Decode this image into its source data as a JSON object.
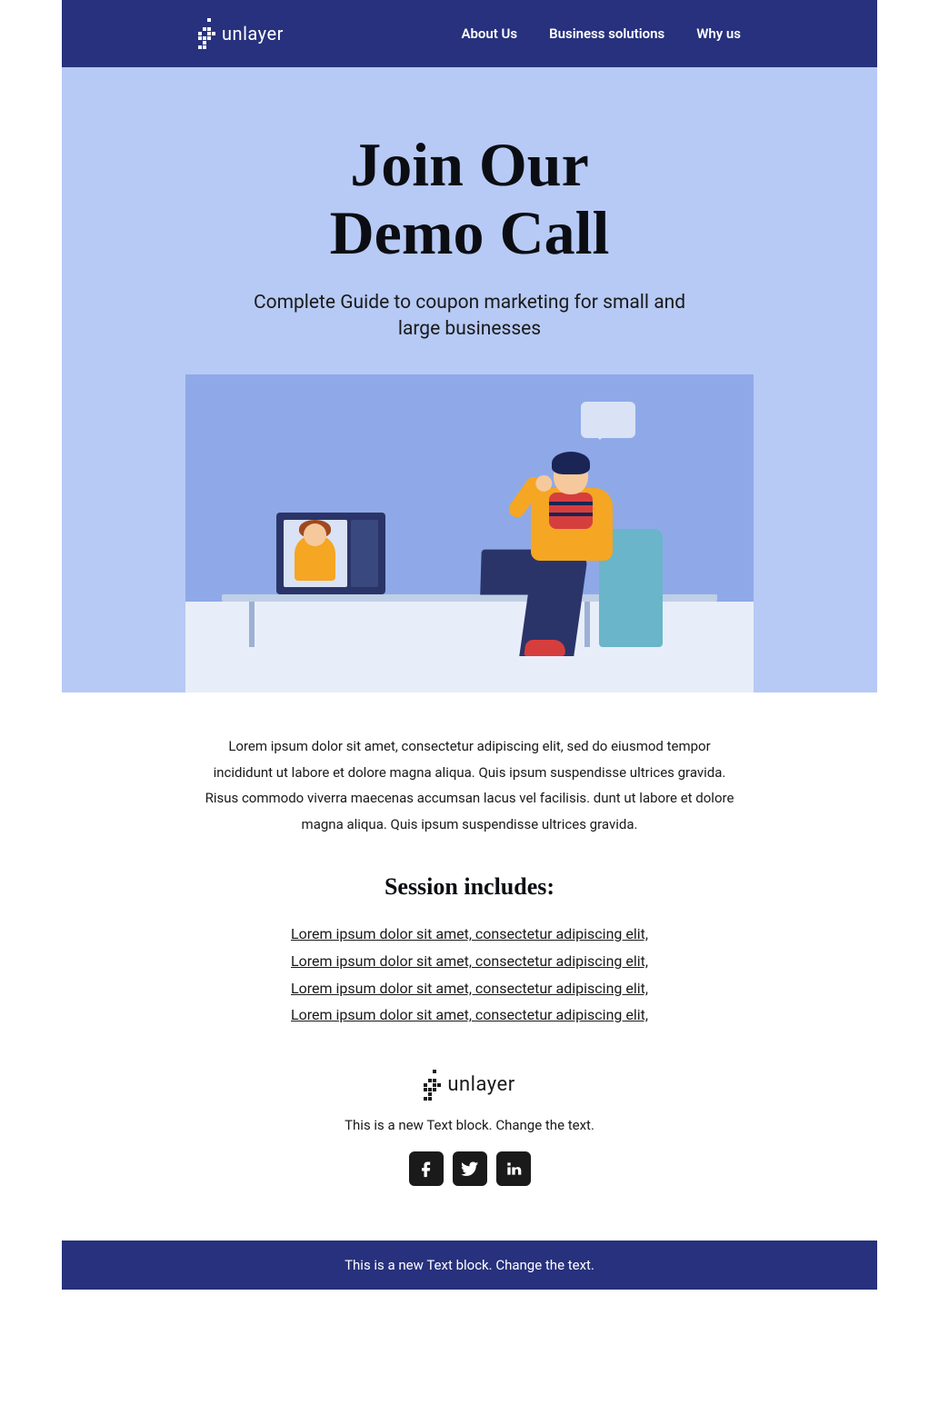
{
  "brand": "unlayer",
  "nav": {
    "items": [
      "About Us",
      "Business solutions",
      "Why us"
    ]
  },
  "hero": {
    "title_line1": "Join Our",
    "title_line2": "Demo Call",
    "subtitle": "Complete Guide to coupon marketing for small and large businesses"
  },
  "body": {
    "paragraph": "Lorem ipsum dolor sit amet, consectetur adipiscing elit, sed do eiusmod tempor incididunt ut labore et dolore magna aliqua. Quis ipsum suspendisse ultrices gravida. Risus commodo viverra maecenas accumsan lacus vel facilisis. dunt ut labore et dolore magna aliqua. Quis ipsum suspendisse ultrices gravida."
  },
  "session": {
    "heading": "Session includes:",
    "items": [
      "Lorem ipsum dolor sit amet, consectetur adipiscing elit,",
      "Lorem ipsum dolor sit amet, consectetur adipiscing elit,",
      "Lorem ipsum dolor sit amet, consectetur adipiscing elit,",
      "Lorem ipsum dolor sit amet, consectetur adipiscing elit,"
    ]
  },
  "footer": {
    "brand": "unlayer",
    "text": "This is a new Text block. Change the text.",
    "bottom_text": "This is a new Text block. Change the text."
  },
  "colors": {
    "header_bg": "#27317d",
    "hero_bg": "#b7caf5",
    "accent1": "#f5a623",
    "accent2": "#2a3468"
  }
}
